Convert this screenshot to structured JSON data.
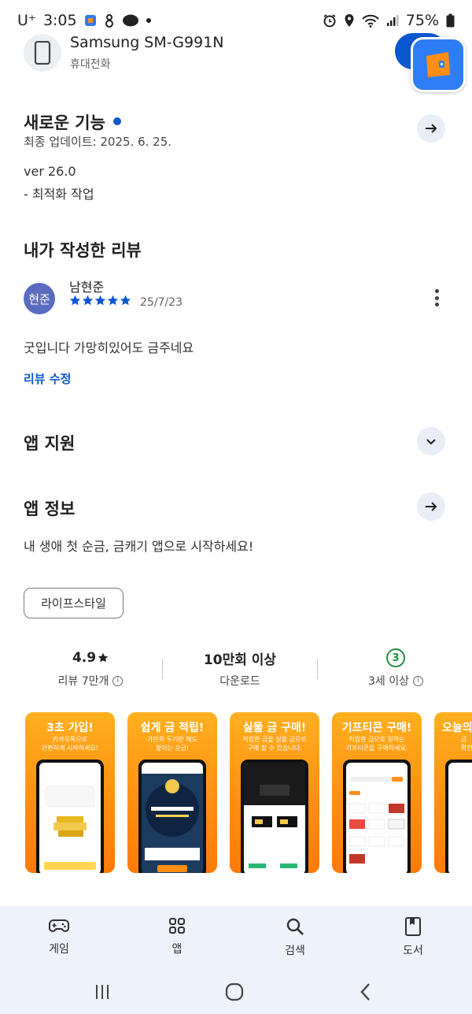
{
  "status_bar": {
    "carrier": "U⁺",
    "time": "3:05",
    "battery": "75%"
  },
  "device": {
    "name": "Samsung SM-G991N",
    "type": "휴대전화"
  },
  "whats_new": {
    "title": "새로운 기능",
    "updated": "최종 업데이트: 2025. 6. 25.",
    "version": "ver 26.0",
    "notes": "- 최적화 작업"
  },
  "my_review": {
    "title": "내가 작성한 리뷰",
    "avatar_text": "현준",
    "reviewer_name": "남현준",
    "rating": 5,
    "date": "25/7/23",
    "text": "굿입니다 가망히있어도 금주네요",
    "edit_label": "리뷰 수정"
  },
  "app_support": {
    "title": "앱 지원"
  },
  "app_info": {
    "title": "앱 정보",
    "description": "내 생애 첫 순금, 금캐기 앱으로 시작하세요!",
    "category_chip": "라이프스타일"
  },
  "stats": {
    "rating": "4.9",
    "reviews": "리뷰 7만개",
    "downloads": "10만회 이상",
    "downloads_label": "다운로드",
    "age_badge": "3",
    "age_label": "3세 이상"
  },
  "screenshots": [
    {
      "title": "3초 가입!",
      "sub1": "카카오톡으로",
      "sub2": "간편하게 시작하세요!"
    },
    {
      "title": "쉽게 금 적립!",
      "sub1": "가만히 두기만 해도",
      "sub2": "쌓이는 순금!"
    },
    {
      "title": "실물 금 구매!",
      "sub1": "적립한 금을 실물 금으로",
      "sub2": "구매 할 수 있습니다."
    },
    {
      "title": "기프티콘 구매!",
      "sub1": "적립한 금으로 원하는",
      "sub2": "기프티콘을 구매하세요."
    },
    {
      "title": "오늘의",
      "sub1": "금",
      "sub2": "확인"
    }
  ],
  "bottom_nav": {
    "games": "게임",
    "apps": "앱",
    "search": "검색",
    "books": "도서"
  },
  "colors": {
    "accent": "#0b57d0",
    "star": "#0b57d0",
    "age_green": "#1e8e3e",
    "shot_orange": "#ff8f12",
    "nav_bg": "#eef2f9"
  }
}
